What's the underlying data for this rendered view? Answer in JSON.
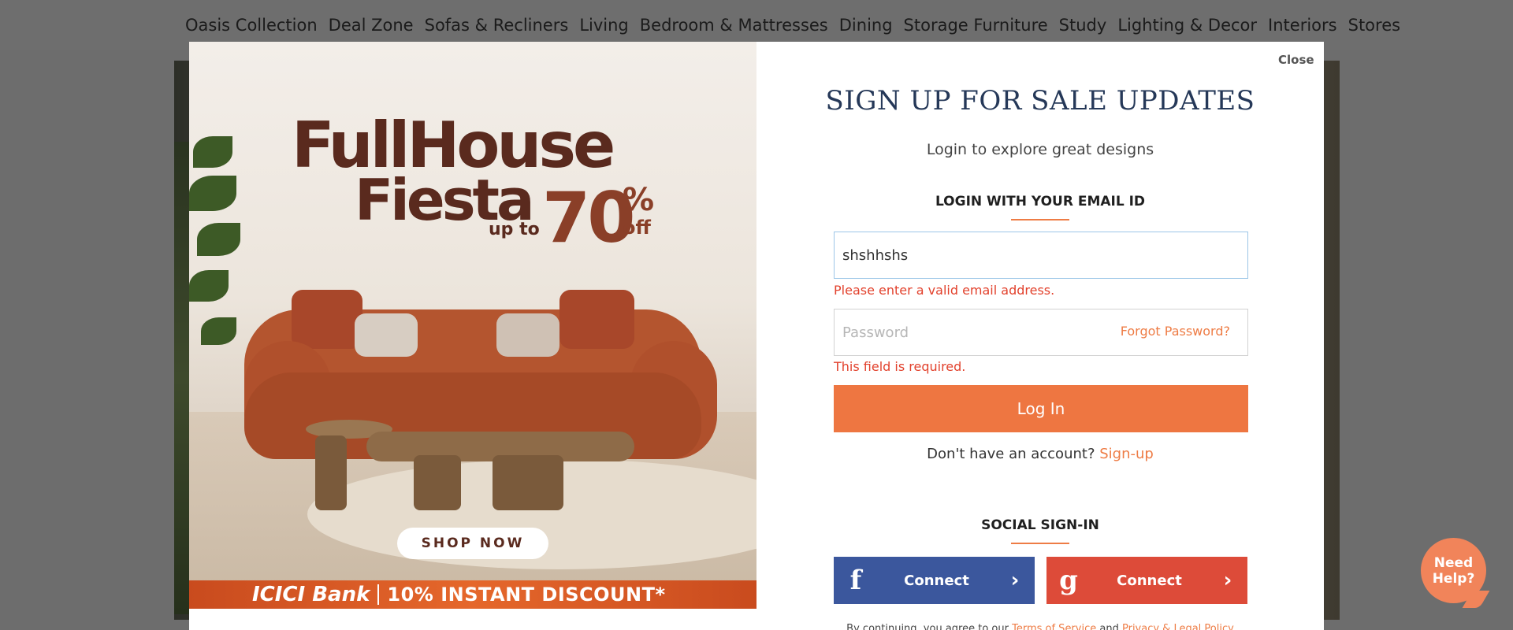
{
  "nav": {
    "items": [
      "Oasis Collection",
      "Deal Zone",
      "Sofas & Recliners",
      "Living",
      "Bedroom & Mattresses",
      "Dining",
      "Storage Furniture",
      "Study",
      "Lighting & Decor",
      "Interiors",
      "Stores"
    ]
  },
  "promo": {
    "line1": "FullHouse",
    "line2": "Fiesta",
    "upto": "up to",
    "percent": "70",
    "percent_sign": "%",
    "off": "off",
    "shop_now": "SHOP NOW",
    "bank_name": "ICICI Bank",
    "bank_offer": "10% INSTANT DISCOUNT*"
  },
  "modal": {
    "close": "Close",
    "title": "SIGN UP FOR SALE UPDATES",
    "subtitle": "Login to explore great designs",
    "email_section": "LOGIN WITH YOUR EMAIL ID",
    "email_value": "shshhshs",
    "email_error": "Please enter a valid email address.",
    "password_placeholder": "Password",
    "forgot_password": "Forgot Password?",
    "password_error": "This field is required.",
    "login_button": "Log In",
    "no_account": "Don't have an account?",
    "signup_link": "Sign-up",
    "social_section": "SOCIAL SIGN-IN",
    "facebook_label": "Connect",
    "google_label": "Connect",
    "terms_prefix": "By continuing, you agree to our",
    "terms_link": "Terms of Service",
    "terms_and": "and",
    "privacy_link": "Privacy & Legal Policy"
  },
  "help": {
    "label": "Need Help?"
  },
  "colors": {
    "accent": "#ee7641",
    "facebook": "#3b579d",
    "google": "#dd4b39",
    "title": "#253858",
    "error": "#e2412c"
  }
}
